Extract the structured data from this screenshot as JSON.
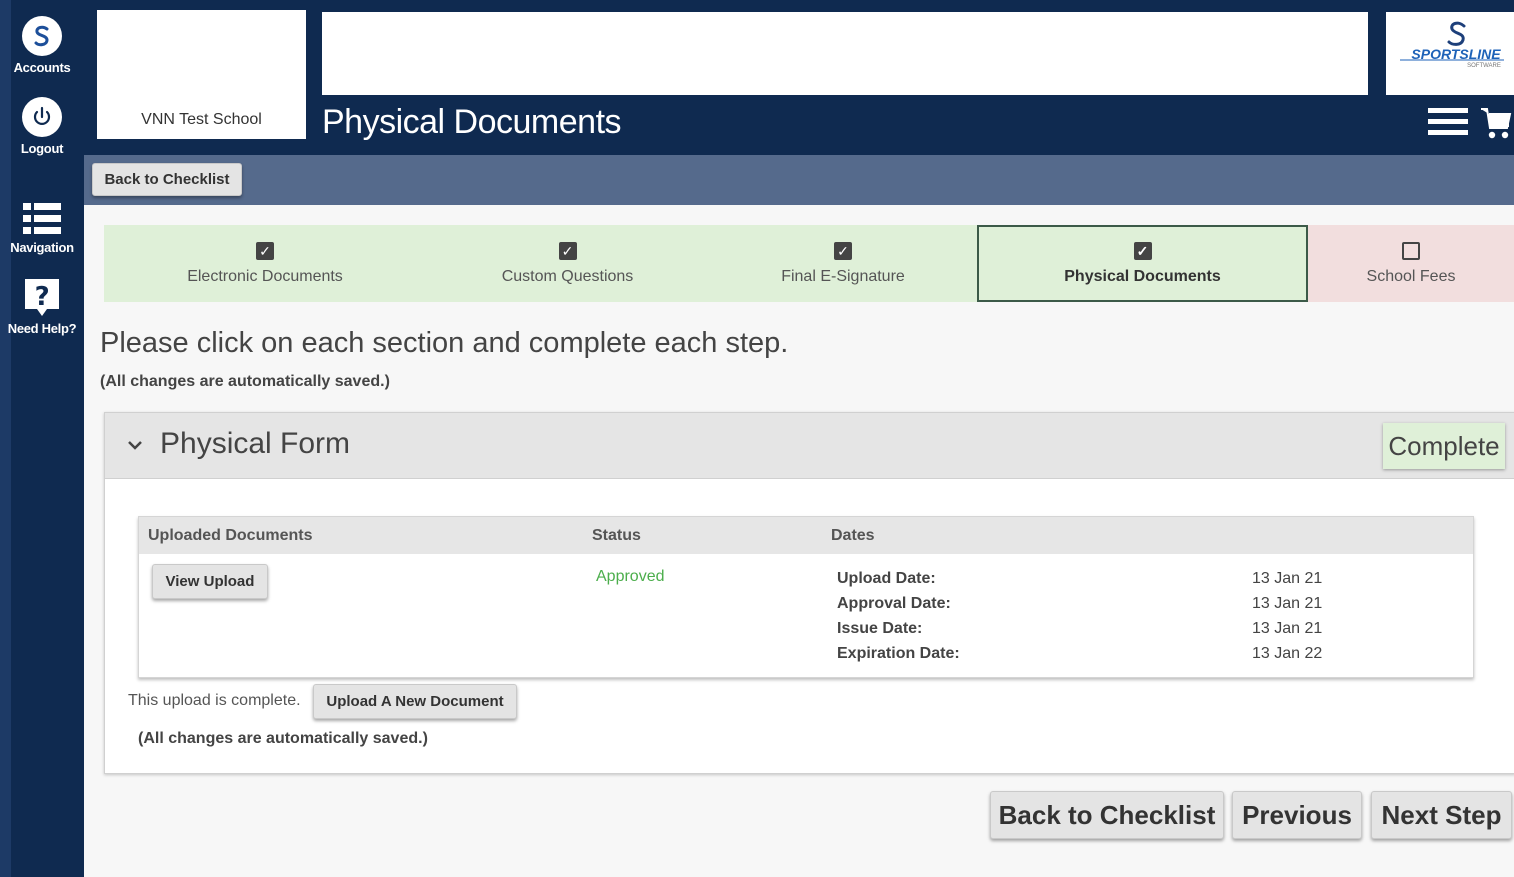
{
  "sidebar": {
    "items": [
      {
        "label": "Accounts",
        "icon": "sportsline-s-icon"
      },
      {
        "label": "Logout",
        "icon": "power-icon"
      },
      {
        "label": "Navigation",
        "icon": "list-icon"
      },
      {
        "label": "Need Help?",
        "icon": "question-icon"
      }
    ]
  },
  "header": {
    "school_name": "VNN Test School",
    "page_title": "Physical Documents",
    "logo_text": "SPORTSLINE",
    "logo_subtext": "SOFTWARE"
  },
  "subbar": {
    "back_label": "Back to Checklist"
  },
  "steps": [
    {
      "label": "Electronic Documents",
      "checked": true,
      "state": "done"
    },
    {
      "label": "Custom Questions",
      "checked": true,
      "state": "done"
    },
    {
      "label": "Final E-Signature",
      "checked": true,
      "state": "done"
    },
    {
      "label": "Physical Documents",
      "checked": true,
      "state": "active"
    },
    {
      "label": "School Fees",
      "checked": false,
      "state": "todo"
    }
  ],
  "main": {
    "instruction": "Please click on each section and complete each step.",
    "saved_note": "(All changes are automatically saved.)"
  },
  "panel": {
    "title": "Physical Form",
    "status_badge": "Complete",
    "table": {
      "headers": [
        "Uploaded Documents",
        "Status",
        "Dates"
      ],
      "view_upload_label": "View Upload",
      "status": "Approved",
      "dates": [
        {
          "label": "Upload Date:",
          "value": "13 Jan 21"
        },
        {
          "label": "Approval Date:",
          "value": "13 Jan 21"
        },
        {
          "label": "Issue Date:",
          "value": "13 Jan 21"
        },
        {
          "label": "Expiration Date:",
          "value": "13 Jan 22"
        }
      ]
    },
    "upload_note": "This upload is complete.",
    "upload_new_label": "Upload A New Document",
    "saved_note": "(All changes are automatically saved.)"
  },
  "footer": {
    "back_label": "Back to Checklist",
    "previous_label": "Previous",
    "next_label": "Next Step"
  },
  "colors": {
    "navy": "#0f2a50",
    "subbar": "#556a8c",
    "done_green": "#dff0d8",
    "todo_red": "#f2dede",
    "approved_green": "#4cae4c"
  }
}
